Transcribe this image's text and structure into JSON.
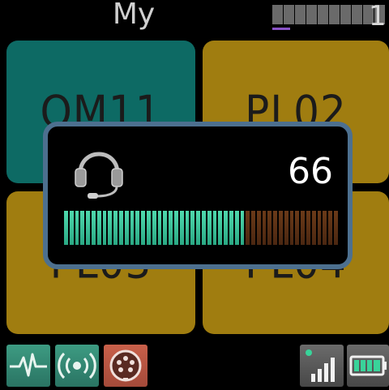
{
  "header": {
    "title": "My",
    "page_count": 10,
    "page_active_index": 0,
    "page_number": "1"
  },
  "groups": [
    {
      "label": "OM11",
      "color": "#0d6a64"
    },
    {
      "label": "PL02",
      "color": "#a07d10"
    },
    {
      "label": "PL03",
      "color": "#a07d10"
    },
    {
      "label": "PL04",
      "color": "#a07d10"
    }
  ],
  "volume_popup": {
    "icon": "headset-icon",
    "value": "66",
    "level_percent": 66,
    "segments": 50,
    "active_color": "#4fd9ad",
    "inactive_color": "#4b2711"
  },
  "status_bar": {
    "buttons": [
      {
        "icon": "heartbeat-icon",
        "color": "#2f8a73"
      },
      {
        "icon": "broadcast-icon",
        "color": "#2f8a73"
      },
      {
        "icon": "dmx-connector-icon",
        "color": "#b95747"
      }
    ],
    "signal_icon": "signal-strength-icon",
    "battery_icon": "battery-icon"
  }
}
